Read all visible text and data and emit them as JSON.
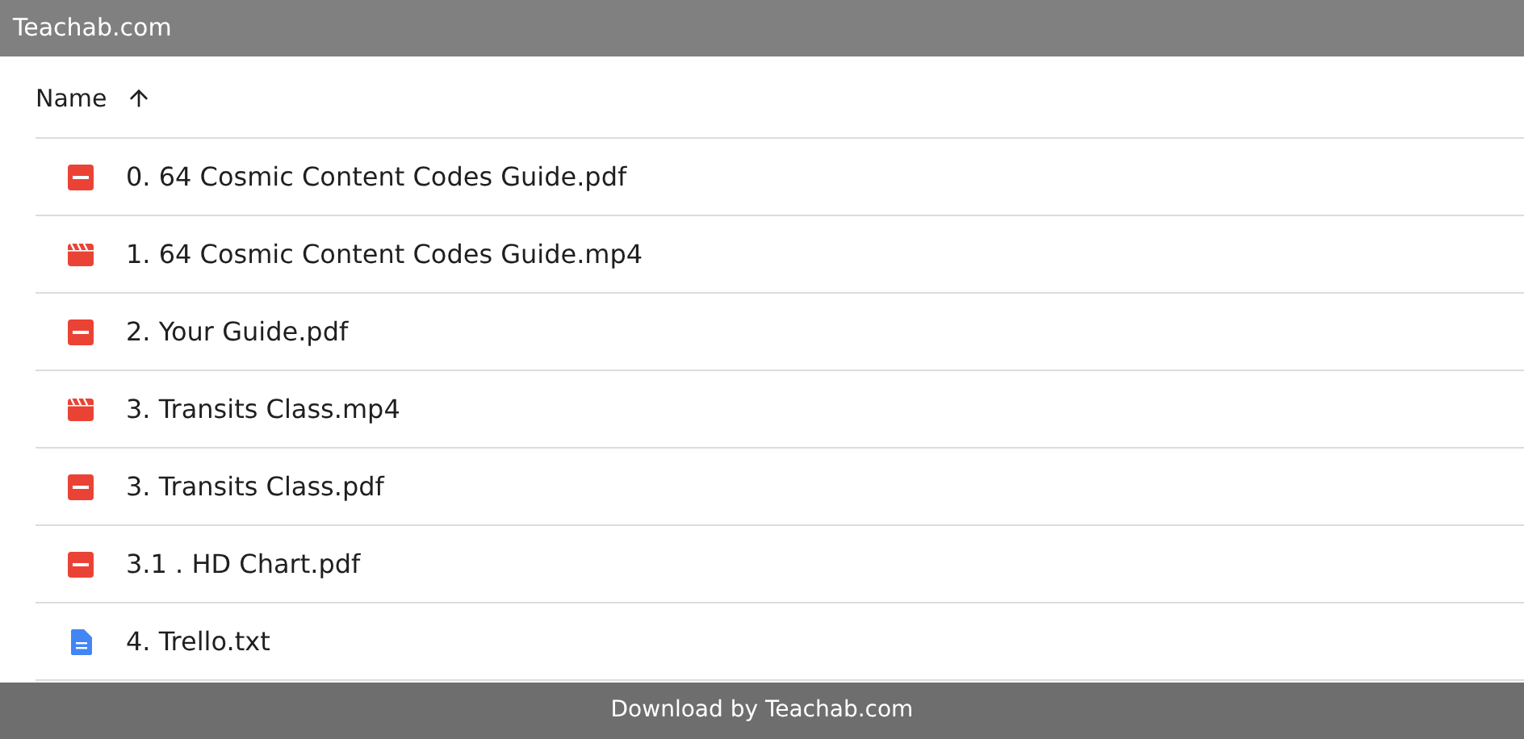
{
  "top_bar": {
    "title": "Teachab.com"
  },
  "list": {
    "column": "Name",
    "sort_ascending": true,
    "files": [
      {
        "name": "0. 64 Cosmic Content Codes Guide.pdf",
        "kind": "pdf"
      },
      {
        "name": "1. 64 Cosmic Content Codes Guide.mp4",
        "kind": "video"
      },
      {
        "name": "2. Your Guide.pdf",
        "kind": "pdf"
      },
      {
        "name": "3. Transits Class.mp4",
        "kind": "video"
      },
      {
        "name": "3. Transits Class.pdf",
        "kind": "pdf"
      },
      {
        "name": "3.1 . HD Chart.pdf",
        "kind": "pdf"
      },
      {
        "name": "4. Trello.txt",
        "kind": "doc"
      }
    ]
  },
  "bottom_bar": {
    "text": "Download by Teachab.com"
  }
}
